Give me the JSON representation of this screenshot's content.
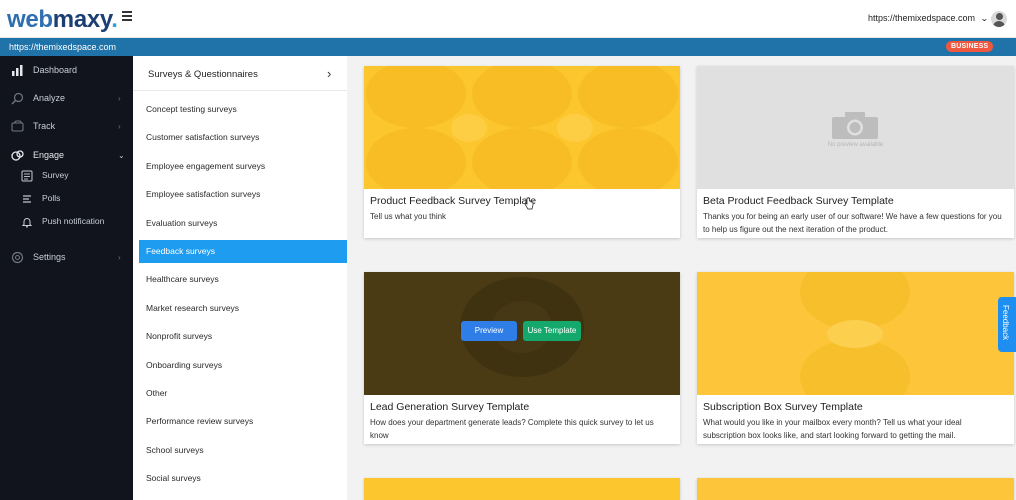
{
  "header": {
    "logo_web": "web",
    "logo_maxy": "maxy",
    "logo_dot": ".",
    "site_selector": "https://themixedspace.com",
    "icons": [
      "hamburger-menu-icon",
      "chevron-down-icon",
      "user-avatar-icon"
    ]
  },
  "urlbar": {
    "url": "https://themixedspace.com",
    "plan_badge": "BUSINESS"
  },
  "sidebar": {
    "items": [
      {
        "label": "Dashboard",
        "icon": "bar-chart-icon"
      },
      {
        "label": "Analyze",
        "icon": "search-analyze-icon"
      },
      {
        "label": "Track",
        "icon": "track-icon"
      },
      {
        "label": "Engage",
        "icon": "engage-icon"
      },
      {
        "label": "Settings",
        "icon": "gear-icon"
      }
    ],
    "engage_sub": [
      {
        "label": "Survey",
        "icon": "survey-icon"
      },
      {
        "label": "Polls",
        "icon": "polls-icon"
      },
      {
        "label": "Push notification",
        "icon": "bell-icon"
      }
    ]
  },
  "categories": {
    "title": "Surveys & Questionnaires",
    "items": [
      "Concept testing surveys",
      "Customer satisfaction surveys",
      "Employee engagement surveys",
      "Employee satisfaction surveys",
      "Evaluation surveys",
      "Feedback surveys",
      "Healthcare surveys",
      "Market research surveys",
      "Nonprofit surveys",
      "Onboarding surveys",
      "Other",
      "Performance review surveys",
      "School surveys",
      "Social surveys"
    ],
    "active": "Feedback surveys"
  },
  "templates": [
    {
      "title": "Product Feedback Survey Template",
      "description": "Tell us what you think"
    },
    {
      "title": "Beta Product Feedback Survey Template",
      "description": "Thanks you for being an early user of our software! We have a few questions for you to help us figure out the next iteration of the product.",
      "thumb_text": "No preview available"
    },
    {
      "title": "Lead Generation Survey Template",
      "description": "How does your department generate leads? Complete this quick survey to let us know"
    },
    {
      "title": "Subscription Box Survey Template",
      "description": "What would you like in your mailbox every month? Tell us what your ideal subscription box looks like, and start looking forward to getting the mail."
    }
  ],
  "hover_actions": {
    "preview": "Preview",
    "use_template": "Use Template"
  },
  "feedback_tab": "Feedback",
  "colors": {
    "brand_blue": "#1f73a8",
    "sidebar_bg": "#11141c",
    "active_category": "#1e9cf0",
    "badge": "#f0573f",
    "thumb_yellow": "#fcc62e",
    "preview_button": "#2f7ee8",
    "use_template_button": "#15a86c"
  }
}
